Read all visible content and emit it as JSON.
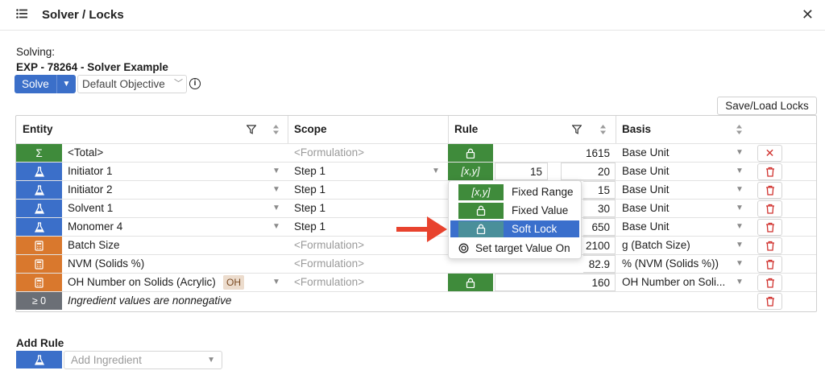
{
  "window": {
    "title": "Solver / Locks"
  },
  "solving": {
    "label": "Solving:",
    "experiment": "EXP - 78264 - Solver Example",
    "solve_button": "Solve",
    "objective": "Default Objective"
  },
  "save_load_label": "Save/Load Locks",
  "table": {
    "headers": {
      "entity": "Entity",
      "scope": "Scope",
      "rule": "Rule",
      "basis": "Basis"
    },
    "rows": [
      {
        "icon": "sigma-icon",
        "color": "#3f8b3b",
        "entity": "<Total>",
        "scope": "<Formulation>",
        "rule_icon": "lock-icon",
        "rule_text": "",
        "value": "1615",
        "basis": "Base Unit",
        "action": "remove-icon"
      },
      {
        "icon": "flask-icon",
        "color": "#3b6fc9",
        "entity": "Initiator 1",
        "scope": "Step 1",
        "rule_icon": "range-icon",
        "rule_text": "[x,y]",
        "min": "15",
        "value": "20",
        "basis": "Base Unit",
        "action": "trash-icon"
      },
      {
        "icon": "flask-icon",
        "color": "#3b6fc9",
        "entity": "Initiator 2",
        "scope": "Step 1",
        "value": "15",
        "basis": "Base Unit",
        "action": "trash-icon"
      },
      {
        "icon": "flask-icon",
        "color": "#3b6fc9",
        "entity": "Solvent 1",
        "scope": "Step 1",
        "value": "30",
        "basis": "Base Unit",
        "action": "trash-icon"
      },
      {
        "icon": "flask-icon",
        "color": "#3b6fc9",
        "entity": "Monomer 4",
        "scope": "Step 1",
        "value": "650",
        "basis": "Base Unit",
        "action": "trash-icon"
      },
      {
        "icon": "calculator-icon",
        "color": "#d9782d",
        "entity": "Batch Size",
        "scope": "<Formulation>",
        "value": "2100",
        "basis": "g (Batch Size)",
        "action": "trash-icon"
      },
      {
        "icon": "calculator-icon",
        "color": "#d9782d",
        "entity": "NVM (Solids %)",
        "scope": "<Formulation>",
        "value": "82.9",
        "basis": "% (NVM (Solids %))",
        "action": "trash-icon"
      },
      {
        "icon": "calculator-icon",
        "color": "#d9782d",
        "entity": "OH Number on Solids (Acrylic)",
        "badge": "OH",
        "scope": "<Formulation>",
        "rule_icon": "lock-icon",
        "value": "160",
        "basis": "OH Number on Soli...",
        "action": "trash-icon"
      },
      {
        "icon": "gte-zero-icon",
        "color": "#6b6f76",
        "icon_text": "≥ 0",
        "entity": "Ingredient values are nonnegative",
        "action": "trash-icon"
      }
    ]
  },
  "dropdown": {
    "items": [
      {
        "icon_text": "[x,y]",
        "label": "Fixed Range"
      },
      {
        "icon_text": "",
        "label": "Fixed Value"
      },
      {
        "icon_text": "",
        "label": "Soft Lock",
        "selected": true
      },
      {
        "label": "Set target Value On"
      }
    ]
  },
  "add_rule": {
    "title": "Add Rule",
    "placeholder": "Add Ingredient"
  },
  "colors": {
    "accent": "#3b6fc9",
    "green": "#3f8b3b",
    "orange": "#d9782d",
    "danger": "#d0312d",
    "arrow": "#e8432e"
  }
}
